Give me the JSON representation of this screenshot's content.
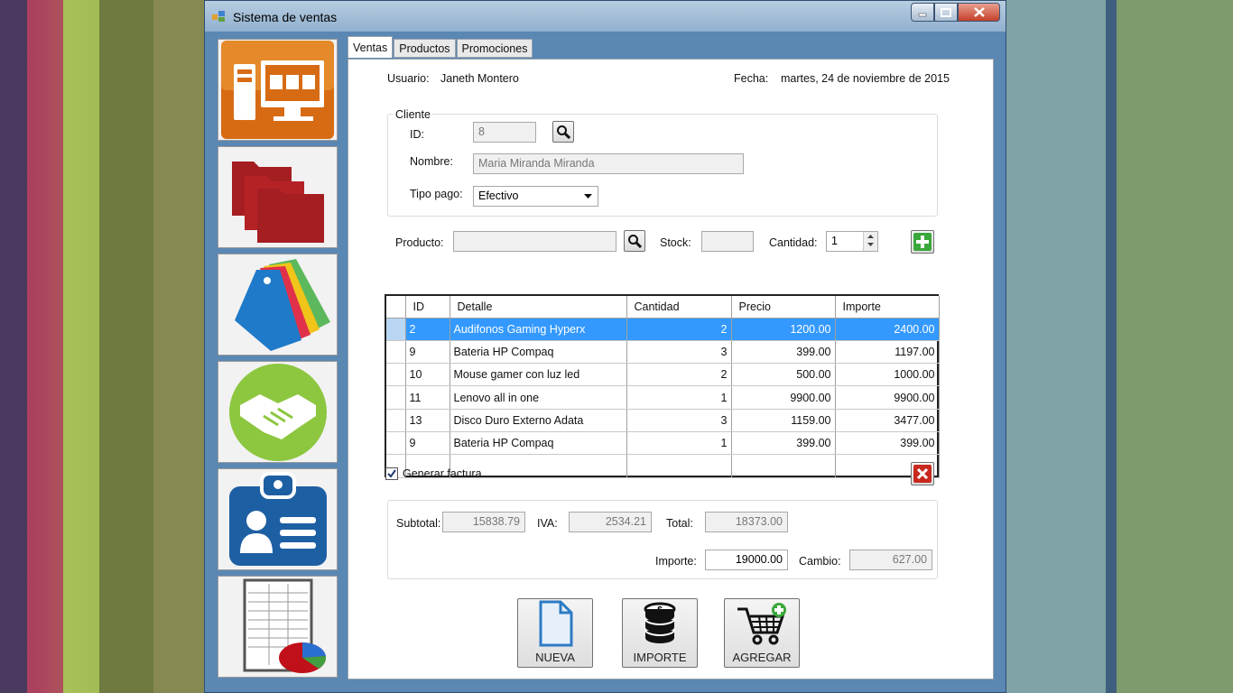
{
  "window": {
    "title": "Sistema de ventas"
  },
  "nav": {
    "items": [
      {
        "name": "ventas"
      },
      {
        "name": "carpetas"
      },
      {
        "name": "promociones"
      },
      {
        "name": "clientes"
      },
      {
        "name": "usuarios"
      },
      {
        "name": "reportes"
      }
    ]
  },
  "tabs": [
    {
      "label": "Ventas",
      "active": true
    },
    {
      "label": "Productos",
      "active": false
    },
    {
      "label": "Promociones",
      "active": false
    }
  ],
  "header": {
    "usuario_label": "Usuario:",
    "usuario_value": "Janeth Montero",
    "fecha_label": "Fecha:",
    "fecha_value": "martes, 24 de noviembre de 2015"
  },
  "cliente": {
    "group_title": "Cliente",
    "id_label": "ID:",
    "id_value": "8",
    "nombre_label": "Nombre:",
    "nombre_value": "Maria Miranda Miranda",
    "tipo_pago_label": "Tipo pago:",
    "tipo_pago_value": "Efectivo"
  },
  "producto": {
    "producto_label": "Producto:",
    "producto_value": "",
    "stock_label": "Stock:",
    "stock_value": "",
    "cantidad_label": "Cantidad:",
    "cantidad_value": "1"
  },
  "grid": {
    "columns": [
      "ID",
      "Detalle",
      "Cantidad",
      "Precio",
      "Importe"
    ],
    "rows": [
      {
        "id": "2",
        "detalle": "Audifonos Gaming Hyperx",
        "cantidad": "2",
        "precio": "1200.00",
        "importe": "2400.00"
      },
      {
        "id": "9",
        "detalle": "Bateria HP Compaq",
        "cantidad": "3",
        "precio": "399.00",
        "importe": "1197.00"
      },
      {
        "id": "10",
        "detalle": "Mouse gamer con luz led",
        "cantidad": "2",
        "precio": "500.00",
        "importe": "1000.00"
      },
      {
        "id": "11",
        "detalle": "Lenovo all in one",
        "cantidad": "1",
        "precio": "9900.00",
        "importe": "9900.00"
      },
      {
        "id": "13",
        "detalle": "Disco Duro Externo Adata",
        "cantidad": "3",
        "precio": "1159.00",
        "importe": "3477.00"
      },
      {
        "id": "9",
        "detalle": "Bateria HP Compaq",
        "cantidad": "1",
        "precio": "399.00",
        "importe": "399.00"
      }
    ]
  },
  "factura": {
    "label": "Generar factura",
    "checked": true
  },
  "totales": {
    "subtotal_label": "Subtotal:",
    "subtotal_value": "15838.79",
    "iva_label": "IVA:",
    "iva_value": "2534.21",
    "total_label": "Total:",
    "total_value": "18373.00",
    "importe_label": "Importe:",
    "importe_value": "19000.00",
    "cambio_label": "Cambio:",
    "cambio_value": "627.00"
  },
  "buttons": {
    "nueva": "NUEVA",
    "importe": "IMPORTE",
    "agregar": "AGREGAR"
  },
  "colors": {
    "selection": "#3399ff",
    "add_green": "#3aa83a",
    "delete_red": "#c8281e"
  }
}
